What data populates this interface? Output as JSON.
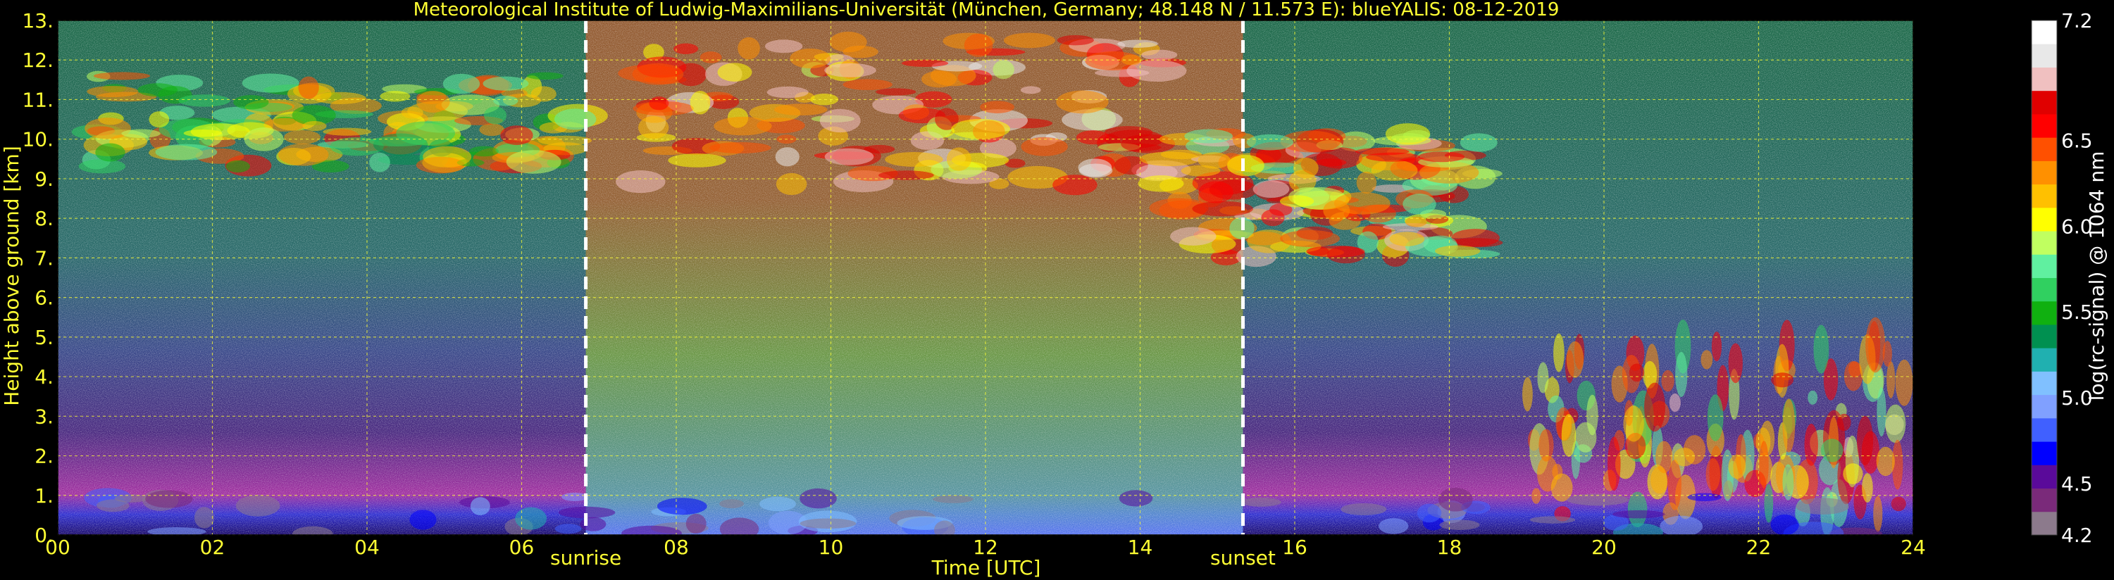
{
  "chart_data": {
    "type": "heatmap",
    "title": "Meteorological Institute of Ludwig-Maximilians-Universität (München, Germany; 48.148 N / 11.573 E):    blueYALIS: 08-12-2019",
    "xlabel": "Time [UTC]",
    "ylabel": "Height above ground [km]",
    "xlim": [
      0,
      24
    ],
    "ylim": [
      0,
      13
    ],
    "x_ticks": [
      "00",
      "02",
      "04",
      "06",
      "08",
      "10",
      "12",
      "14",
      "16",
      "18",
      "20",
      "22",
      "24"
    ],
    "y_ticks": [
      "0.",
      "1.",
      "2.",
      "3.",
      "4.",
      "5.",
      "6.",
      "7.",
      "8.",
      "9.",
      "10.",
      "11.",
      "12.",
      "13."
    ],
    "grid": true,
    "markers": [
      {
        "label": "sunrise",
        "x": 6.83
      },
      {
        "label": "sunset",
        "x": 15.33
      }
    ],
    "colorbar": {
      "label": "log(rc-signal) @ 1064 nm",
      "range": [
        4.2,
        7.2
      ],
      "ticks": [
        "4.2",
        "4.5",
        "5.0",
        "5.5",
        "6.0",
        "6.5",
        "7.2"
      ],
      "tick_values": [
        4.2,
        4.5,
        5.0,
        5.5,
        6.0,
        6.5,
        7.2
      ],
      "colors": [
        "#8c7a8c",
        "#7a2a7a",
        "#5a0a9a",
        "#0000ff",
        "#4060ff",
        "#80a0ff",
        "#80c0ff",
        "#20b0b0",
        "#009050",
        "#10b010",
        "#30d060",
        "#60f0a0",
        "#c0ff60",
        "#ffff00",
        "#ffc000",
        "#ff9000",
        "#ff5000",
        "#ff0000",
        "#e00000",
        "#f0c0c0",
        "#e8e8e8",
        "#ffffff"
      ]
    },
    "features": [
      {
        "kind": "cirrus",
        "x": [
          0.5,
          6.8
        ],
        "y": [
          9.3,
          11.6
        ],
        "level": 6.0
      },
      {
        "kind": "cirrus",
        "x": [
          7.5,
          14.5
        ],
        "y": [
          8.8,
          12.5
        ],
        "level": 6.5
      },
      {
        "kind": "cirrus",
        "x": [
          14.5,
          18.5
        ],
        "y": [
          7.0,
          10.2
        ],
        "level": 6.3
      },
      {
        "kind": "convective",
        "x": [
          19.0,
          23.9
        ],
        "y": [
          0.5,
          4.8
        ],
        "level": 6.2
      },
      {
        "kind": "boundary_layer",
        "x": [
          0,
          24
        ],
        "y": [
          0,
          1.0
        ],
        "level": 4.6
      }
    ]
  }
}
